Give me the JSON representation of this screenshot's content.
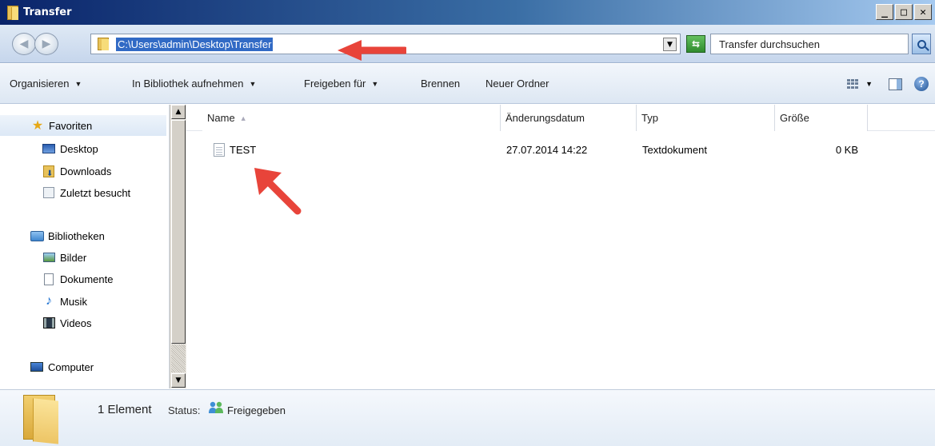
{
  "window": {
    "title": "Transfer",
    "controls": {
      "minimize": "_",
      "maximize": "□",
      "close": "✕"
    }
  },
  "address_bar": {
    "path": "C:\\Users\\admin\\Desktop\\Transfer",
    "search_placeholder": "Transfer durchsuchen"
  },
  "toolbar": {
    "items": [
      {
        "label": "Organisieren",
        "has_dropdown": true
      },
      {
        "label": "In Bibliothek aufnehmen",
        "has_dropdown": true
      },
      {
        "label": "Freigeben für",
        "has_dropdown": true
      },
      {
        "label": "Brennen",
        "has_dropdown": false
      },
      {
        "label": "Neuer Ordner",
        "has_dropdown": false
      }
    ]
  },
  "sidebar": {
    "favorites": {
      "label": "Favoriten",
      "items": [
        {
          "label": "Desktop",
          "icon": "desktop-icon"
        },
        {
          "label": "Downloads",
          "icon": "downloads-icon"
        },
        {
          "label": "Zuletzt besucht",
          "icon": "recent-places-icon"
        }
      ]
    },
    "libraries": {
      "label": "Bibliotheken",
      "items": [
        {
          "label": "Bilder",
          "icon": "pictures-icon"
        },
        {
          "label": "Dokumente",
          "icon": "documents-icon"
        },
        {
          "label": "Musik",
          "icon": "music-icon"
        },
        {
          "label": "Videos",
          "icon": "videos-icon"
        }
      ]
    },
    "computer": {
      "label": "Computer",
      "icon": "computer-icon"
    }
  },
  "file_list": {
    "columns": [
      "Name",
      "Änderungsdatum",
      "Typ",
      "Größe"
    ],
    "rows": [
      {
        "name": "TEST",
        "date": "27.07.2014 14:22",
        "type": "Textdokument",
        "size": "0 KB",
        "icon": "text-file-icon"
      }
    ]
  },
  "status_bar": {
    "count": "1 Element",
    "status_label": "Status:",
    "status_value": "Freigegeben"
  },
  "colors": {
    "title_gradient_start": "#0a246a",
    "title_gradient_end": "#a6caf0",
    "selection": "#316ac5",
    "annotation_arrow": "#e8443a"
  }
}
